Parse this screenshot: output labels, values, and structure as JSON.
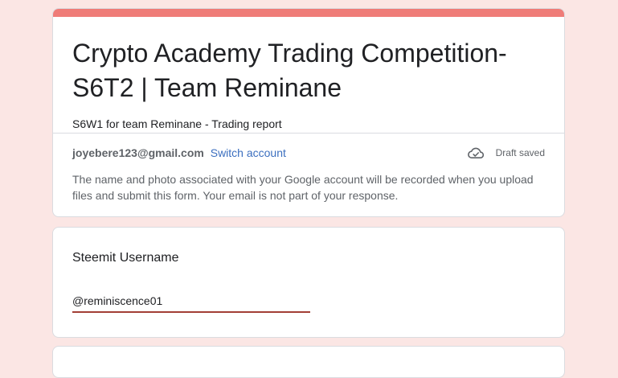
{
  "form": {
    "title": "Crypto Academy Trading Competition-S6T2 | Team Reminane",
    "description": "S6W1 for team Reminane - Trading report",
    "accent_color": "#ef7c78",
    "background_color": "#fbe6e4"
  },
  "account": {
    "email": "joyebere123@gmail.com",
    "switch_label": "Switch account",
    "status_icon": "cloud-done-icon",
    "status_text": "Draft saved",
    "notice": "The name and photo associated with your Google account will be recorded when you upload files and submit this form. Your email is not part of your response."
  },
  "questions": [
    {
      "label": "Steemit Username",
      "value": "@reminiscence01"
    }
  ]
}
